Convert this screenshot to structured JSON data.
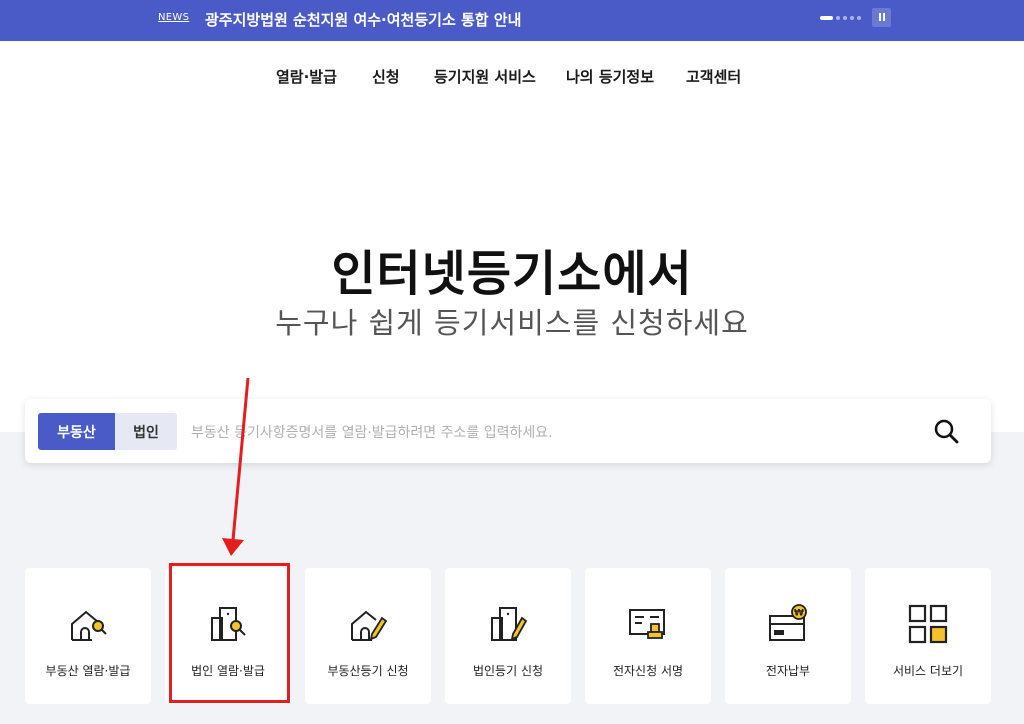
{
  "topbar": {
    "news_tag": "NEWS",
    "news_text": "광주지방법원 순천지원 여수·여천등기소 통합 안내"
  },
  "gnb": {
    "items": [
      "열람·발급",
      "신청",
      "등기지원 서비스",
      "나의 등기정보",
      "고객센터"
    ]
  },
  "hero": {
    "title": "인터넷등기소에서",
    "subtitle": "누구나 쉽게 등기서비스를 신청하세요"
  },
  "search": {
    "tabs": [
      "부동산",
      "법인"
    ],
    "active_tab": "부동산",
    "placeholder": "부동산 등기사항증명서를 열람·발급하려면 주소를 입력하세요."
  },
  "services": [
    {
      "label": "부동산 열람·발급",
      "icon": "house-search-icon"
    },
    {
      "label": "법인 열람·발급",
      "icon": "building-search-icon"
    },
    {
      "label": "부동산등기 신청",
      "icon": "house-edit-icon"
    },
    {
      "label": "법인등기 신청",
      "icon": "building-edit-icon"
    },
    {
      "label": "전자신청 서명",
      "icon": "document-stamp-icon"
    },
    {
      "label": "전자납부",
      "icon": "wallet-won-icon"
    },
    {
      "label": "서비스 더보기",
      "icon": "grid-more-icon"
    }
  ],
  "colors": {
    "brand": "#4a5bc7",
    "accent": "#f4c32b",
    "annotation": "#e41e1e"
  }
}
